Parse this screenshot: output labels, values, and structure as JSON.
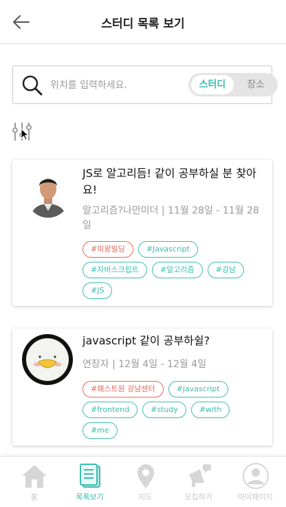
{
  "header": {
    "title": "스터디 목록 보기",
    "back_icon": "arrow-left-icon"
  },
  "search": {
    "placeholder": "위치를 입력하세요.",
    "value": "",
    "toggle_options": [
      "스터디",
      "장소"
    ],
    "selected": "스터디"
  },
  "colors": {
    "accent": "#3cbdb0",
    "tag_red": "#e06a58",
    "inactive": "#c6c6c6"
  },
  "studies": [
    {
      "title": "JS로 알고리듬! 같이 공부하실 분 찾아요!",
      "meta": "알고리즘?나만미더 | 11월 28일 - 11월 28일",
      "tags": [
        "#미왕빌딩",
        "#Javascript",
        "#자바스크립트",
        "#알고리즘",
        "#강남",
        "#JS"
      ]
    },
    {
      "title": "javascript 같이 공부하쉴?",
      "meta": "연장자 | 12월 4일 - 12월 4일",
      "tags": [
        "#패스트원 강남센터",
        "#javascript",
        "#frontend",
        "#study",
        "#with",
        "#me"
      ]
    }
  ],
  "tabbar": {
    "items": [
      {
        "label": "홈",
        "icon": "home-icon"
      },
      {
        "label": "목록보기",
        "icon": "list-icon"
      },
      {
        "label": "지도",
        "icon": "map-pin-icon"
      },
      {
        "label": "모집하기",
        "icon": "megaphone-icon"
      },
      {
        "label": "마이페이지",
        "icon": "user-icon"
      }
    ],
    "active": "목록보기"
  }
}
